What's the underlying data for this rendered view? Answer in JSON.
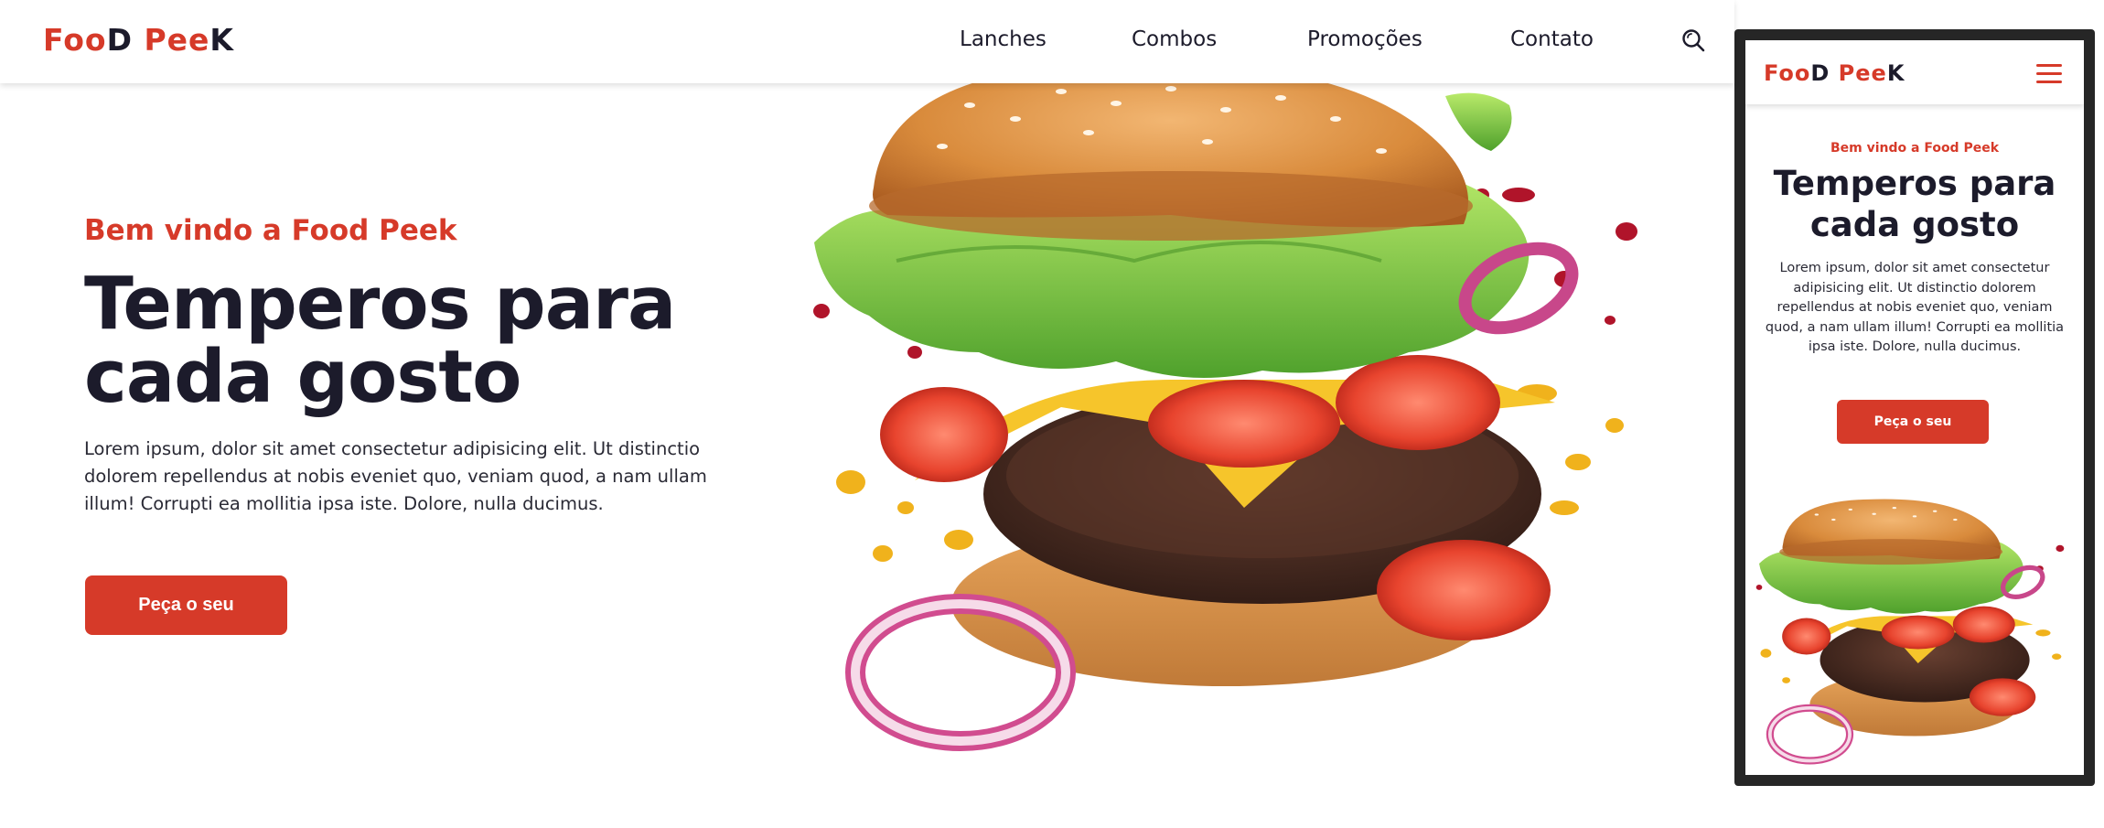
{
  "brand": {
    "name_part1": "Foo",
    "name_part2": "D",
    "name_part3": " Pee",
    "name_part4": "K"
  },
  "nav": {
    "items": [
      "Lanches",
      "Combos",
      "Promoções",
      "Contato"
    ]
  },
  "icons": {
    "search": "search-icon",
    "menu": "hamburger-menu-icon"
  },
  "hero": {
    "welcome": "Bem vindo a Food Peek",
    "headline_line1": "Temperos para",
    "headline_line2": "cada gosto",
    "lead": "Lorem ipsum, dolor sit amet consectetur adipisicing elit. Ut distinctio dolorem repellendus at nobis eveniet quo, veniam quod, a nam ullam illum! Corrupti ea mollitia ipsa iste. Dolore, nulla ducimus.",
    "cta": "Peça o seu"
  },
  "colors": {
    "accent": "#d63a29",
    "text_dark": "#1c1b2b",
    "phone_frame": "#262626"
  }
}
